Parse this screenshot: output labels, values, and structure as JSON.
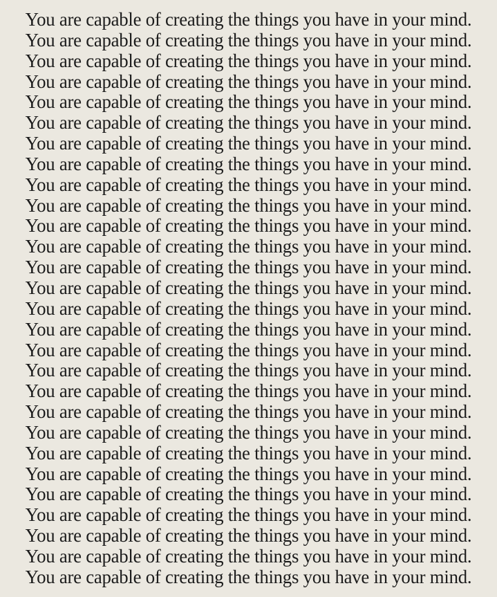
{
  "lines": [
    "You are capable of creating the things you have in your mind.",
    "You are capable of creating the things you have in your mind.",
    "You are capable of creating the things you have in your mind.",
    "You are capable of creating the things you have in your mind.",
    "You are capable of creating the things you have in your mind.",
    "You are capable of creating the things you have in your mind.",
    "You are capable of creating the things you have in your mind.",
    "You are capable of creating the things you have in your mind.",
    "You are capable of creating the things you have in your mind.",
    "You are capable of creating the things you have in your mind.",
    "You are capable of creating the things you have in your mind.",
    "You are capable of creating the things you have in your mind.",
    "You are capable of creating the things you have in your mind.",
    "You are capable of creating the things you have in your mind.",
    "You are capable of creating the things you have in your mind.",
    "You are capable of creating the things you have in your mind.",
    "You are capable of creating the things you have in your mind.",
    "You are capable of creating the things you have in your mind.",
    "You are capable of creating the things you have in your mind.",
    "You are capable of creating the things you have in your mind.",
    "You are capable of creating the things you have in your mind.",
    "You are capable of creating the things you have in your mind.",
    "You are capable of creating the things you have in your mind.",
    "You are capable of creating the things you have in your mind.",
    "You are capable of creating the things you have in your mind.",
    "You are capable of creating the things you have in your mind.",
    "You are capable of creating the things you have in your mind.",
    "You are capable of creating the things you have in your mind."
  ],
  "colors": {
    "background": "#ebe8e0",
    "text": "#1c1c1c"
  }
}
